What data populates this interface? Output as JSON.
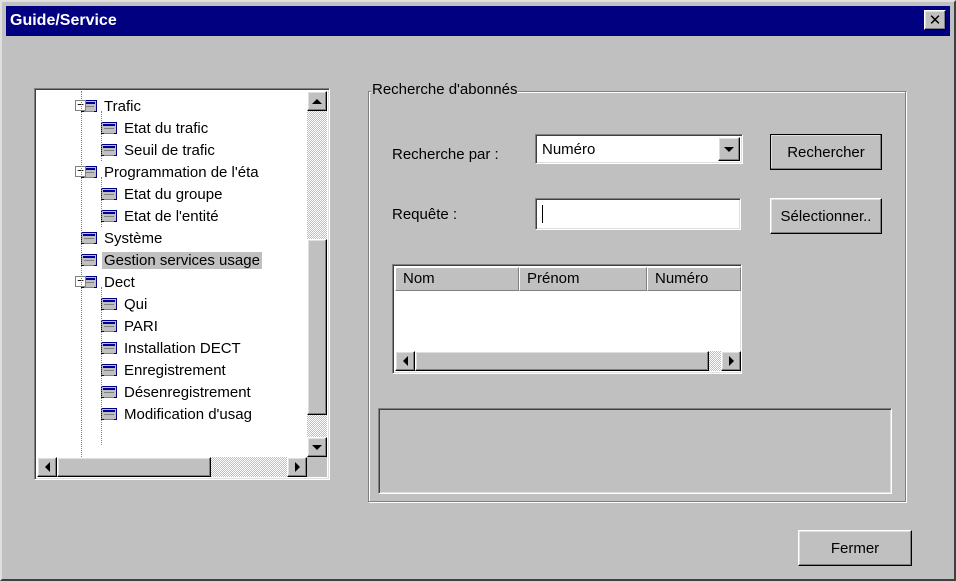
{
  "window": {
    "title": "Guide/Service"
  },
  "tree": {
    "items": [
      {
        "label": "Trafic",
        "level": 1,
        "expander": "−"
      },
      {
        "label": "Etat du trafic",
        "level": 2
      },
      {
        "label": "Seuil de trafic",
        "level": 2
      },
      {
        "label": "Programmation de l'éta",
        "level": 1,
        "expander": "−"
      },
      {
        "label": "Etat du groupe",
        "level": 2
      },
      {
        "label": "Etat de l'entité",
        "level": 2
      },
      {
        "label": "Système",
        "level": 1
      },
      {
        "label": "Gestion services usage",
        "level": 1,
        "selected": true
      },
      {
        "label": "Dect",
        "level": 1,
        "expander": "−"
      },
      {
        "label": "Qui",
        "level": 2
      },
      {
        "label": "PARI",
        "level": 2
      },
      {
        "label": "Installation DECT",
        "level": 2
      },
      {
        "label": "Enregistrement",
        "level": 2
      },
      {
        "label": "Désenregistrement",
        "level": 2
      },
      {
        "label": "Modification d'usag",
        "level": 2
      }
    ]
  },
  "search": {
    "group_title": "Recherche d'abonnés",
    "by_label": "Recherche par :",
    "by_value": "Numéro",
    "query_label": "Requête :",
    "query_value": "",
    "search_button": "Rechercher",
    "select_button": "Sélectionner..",
    "columns": [
      "Nom",
      "Prénom",
      "Numéro"
    ]
  },
  "footer": {
    "close_button": "Fermer"
  }
}
